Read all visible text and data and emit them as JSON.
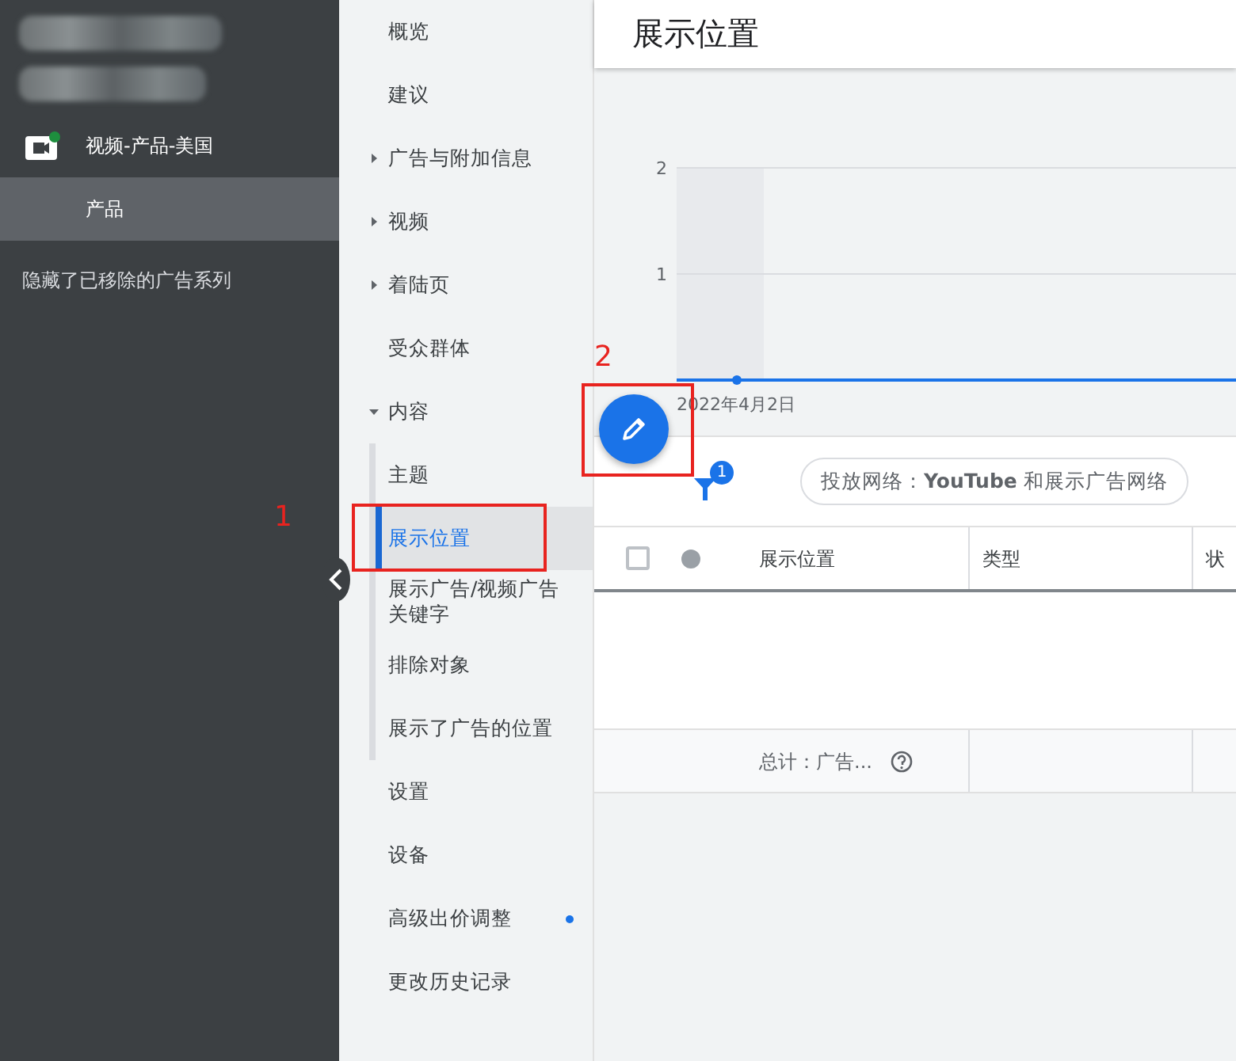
{
  "account": {
    "campaign": "视频-产品-美国",
    "campaign_active": true,
    "ad_groups": [
      {
        "label": "产品",
        "selected": true
      }
    ],
    "hidden_note": "隐藏了已移除的广告系列"
  },
  "nav": [
    {
      "label": "概览",
      "kind": "leaf",
      "selected": false,
      "dot": false
    },
    {
      "label": "建议",
      "kind": "leaf",
      "selected": false,
      "dot": false
    },
    {
      "label": "广告与附加信息",
      "kind": "group",
      "expanded": false,
      "selected": false,
      "dot": false
    },
    {
      "label": "视频",
      "kind": "group",
      "expanded": false,
      "selected": false,
      "dot": false
    },
    {
      "label": "着陆页",
      "kind": "group",
      "expanded": false,
      "selected": false,
      "dot": false
    },
    {
      "label": "受众群体",
      "kind": "leaf",
      "selected": false,
      "dot": false
    },
    {
      "label": "内容",
      "kind": "group",
      "expanded": true,
      "selected": false,
      "dot": false,
      "children": [
        {
          "label": "主题",
          "selected": false
        },
        {
          "label": "展示位置",
          "selected": true
        },
        {
          "label": "展示广告/视频广告关键字",
          "selected": false
        },
        {
          "label": "排除对象",
          "selected": false
        },
        {
          "label": "展示了广告的位置",
          "selected": false
        }
      ]
    },
    {
      "label": "设置",
      "kind": "leaf",
      "selected": false,
      "dot": false
    },
    {
      "label": "设备",
      "kind": "leaf",
      "selected": false,
      "dot": false
    },
    {
      "label": "高级出价调整",
      "kind": "leaf",
      "selected": false,
      "dot": true
    },
    {
      "label": "更改历史记录",
      "kind": "leaf",
      "selected": false,
      "dot": false
    }
  ],
  "page_title": "展示位置",
  "chart": {
    "chart_data": {
      "type": "line",
      "categories": [
        "2022年4月2日"
      ],
      "series": [
        {
          "color": "#1a73e8",
          "marker": "circle",
          "values": [
            0
          ]
        }
      ],
      "ylim": [
        0,
        2
      ],
      "yticks": [
        1,
        2
      ]
    }
  },
  "toolbar": {
    "filter_count": "1",
    "chip": "投放网络：**YouTube** 和展示广告网络"
  },
  "table": {
    "select_all_checked": false,
    "columns": [
      "展示位置",
      "类型",
      "状"
    ],
    "total": "总计：广告..."
  },
  "annotations": [
    {
      "label": "1"
    },
    {
      "label": "2"
    }
  ]
}
